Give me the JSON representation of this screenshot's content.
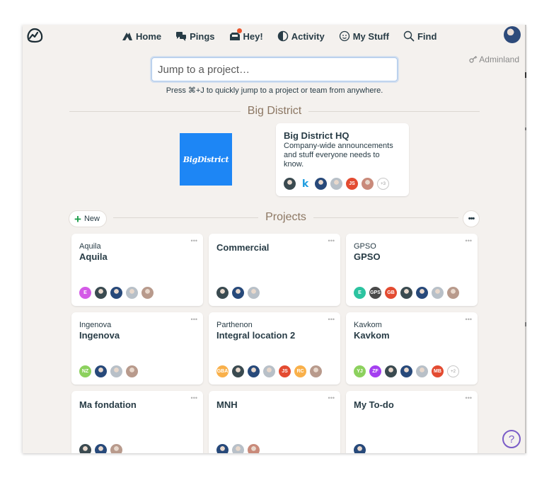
{
  "nav": {
    "items": [
      {
        "id": "home",
        "label": "Home",
        "icon": "home-icon"
      },
      {
        "id": "pings",
        "label": "Pings",
        "icon": "pings-icon"
      },
      {
        "id": "hey",
        "label": "Hey!",
        "icon": "hey-icon",
        "badge": true
      },
      {
        "id": "activity",
        "label": "Activity",
        "icon": "activity-icon"
      },
      {
        "id": "mystuff",
        "label": "My Stuff",
        "icon": "smiley-icon"
      },
      {
        "id": "find",
        "label": "Find",
        "icon": "search-icon"
      }
    ],
    "adminland": "Adminland"
  },
  "jump": {
    "placeholder": "Jump to a project…",
    "hint": "Press ⌘+J to quickly jump to a project or team from anywhere."
  },
  "company": {
    "title": "Big District",
    "logo_text": "BigDistrict",
    "logo_color": "#1d86f5",
    "hq": {
      "title": "Big District HQ",
      "description": "Company-wide announcements and stuff everyone needs to know.",
      "avatars": [
        {
          "type": "photo",
          "color": "#3a4a50"
        },
        {
          "type": "k",
          "text": "k"
        },
        {
          "type": "photo",
          "color": "#27497a"
        },
        {
          "type": "photo",
          "color": "#b8c0c8"
        },
        {
          "type": "initials",
          "text": "JS",
          "color": "#e34b31"
        },
        {
          "type": "photo",
          "color": "#c98a7a"
        },
        {
          "type": "more",
          "text": "+3"
        }
      ]
    }
  },
  "projects": {
    "title": "Projects",
    "new_label": "New",
    "more_label": "•••",
    "cards": [
      {
        "sub": "Aquila",
        "name": "Aquila",
        "avatars": [
          {
            "type": "initials",
            "text": "E",
            "color": "#d45be7"
          },
          {
            "type": "photo",
            "color": "#3a4a50"
          },
          {
            "type": "photo",
            "color": "#27497a"
          },
          {
            "type": "photo",
            "color": "#b8c0c8"
          },
          {
            "type": "photo",
            "color": "#b89a8c"
          }
        ]
      },
      {
        "sub": "",
        "name": "Commercial",
        "avatars": [
          {
            "type": "photo",
            "color": "#3a4a50"
          },
          {
            "type": "photo",
            "color": "#27497a"
          },
          {
            "type": "photo",
            "color": "#b8c0c8"
          }
        ]
      },
      {
        "sub": "GPSO",
        "name": "GPSO",
        "avatars": [
          {
            "type": "initials",
            "text": "E",
            "color": "#2cc3a0"
          },
          {
            "type": "initials",
            "text": "GPS",
            "color": "#4a4a4a"
          },
          {
            "type": "initials",
            "text": "GB",
            "color": "#e34b31"
          },
          {
            "type": "photo",
            "color": "#3a4a50"
          },
          {
            "type": "photo",
            "color": "#27497a"
          },
          {
            "type": "photo",
            "color": "#b8c0c8"
          },
          {
            "type": "photo",
            "color": "#b89a8c"
          }
        ]
      },
      {
        "sub": "Ingenova",
        "name": "Ingenova",
        "avatars": [
          {
            "type": "initials",
            "text": "NZ",
            "color": "#8cd15e"
          },
          {
            "type": "photo",
            "color": "#27497a"
          },
          {
            "type": "photo",
            "color": "#b8c0c8"
          },
          {
            "type": "photo",
            "color": "#b89a8c"
          }
        ]
      },
      {
        "sub": "Parthenon",
        "name": "Integral location 2",
        "avatars": [
          {
            "type": "initials",
            "text": "GBA",
            "color": "#f9b04a"
          },
          {
            "type": "photo",
            "color": "#3a4a50"
          },
          {
            "type": "photo",
            "color": "#27497a"
          },
          {
            "type": "photo",
            "color": "#b8c0c8"
          },
          {
            "type": "initials",
            "text": "JS",
            "color": "#e34b31"
          },
          {
            "type": "initials",
            "text": "RC",
            "color": "#f9b04a"
          },
          {
            "type": "photo",
            "color": "#b89a8c"
          }
        ]
      },
      {
        "sub": "Kavkom",
        "name": "Kavkom",
        "avatars": [
          {
            "type": "initials",
            "text": "YJ",
            "color": "#8cd15e"
          },
          {
            "type": "initials",
            "text": "ZF",
            "color": "#a43ff0"
          },
          {
            "type": "photo",
            "color": "#3a4a50"
          },
          {
            "type": "photo",
            "color": "#27497a"
          },
          {
            "type": "photo",
            "color": "#b8c0c8"
          },
          {
            "type": "initials",
            "text": "MB",
            "color": "#e34b31"
          },
          {
            "type": "more",
            "text": "+2"
          }
        ]
      },
      {
        "sub": "",
        "name": "Ma fondation",
        "avatars": [
          {
            "type": "photo",
            "color": "#3a4a50"
          },
          {
            "type": "photo",
            "color": "#27497a"
          },
          {
            "type": "photo",
            "color": "#b89a8c"
          }
        ]
      },
      {
        "sub": "",
        "name": "MNH",
        "avatars": [
          {
            "type": "photo",
            "color": "#27497a"
          },
          {
            "type": "photo",
            "color": "#b8c0c8"
          },
          {
            "type": "photo",
            "color": "#c98a7a"
          }
        ]
      },
      {
        "sub": "",
        "name": "My To-do",
        "avatars": [
          {
            "type": "photo",
            "color": "#27497a"
          }
        ]
      }
    ]
  },
  "help": {
    "label": "?"
  }
}
